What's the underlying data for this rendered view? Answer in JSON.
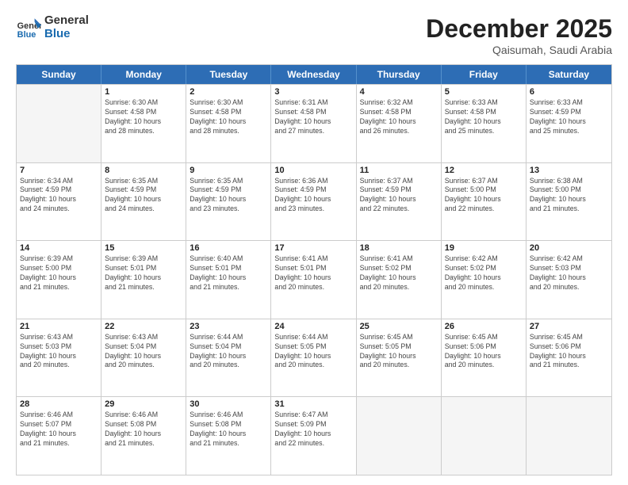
{
  "header": {
    "logo_general": "General",
    "logo_blue": "Blue",
    "month": "December 2025",
    "location": "Qaisumah, Saudi Arabia"
  },
  "weekdays": [
    "Sunday",
    "Monday",
    "Tuesday",
    "Wednesday",
    "Thursday",
    "Friday",
    "Saturday"
  ],
  "rows": [
    [
      {
        "day": "",
        "info": ""
      },
      {
        "day": "1",
        "info": "Sunrise: 6:30 AM\nSunset: 4:58 PM\nDaylight: 10 hours\nand 28 minutes."
      },
      {
        "day": "2",
        "info": "Sunrise: 6:30 AM\nSunset: 4:58 PM\nDaylight: 10 hours\nand 28 minutes."
      },
      {
        "day": "3",
        "info": "Sunrise: 6:31 AM\nSunset: 4:58 PM\nDaylight: 10 hours\nand 27 minutes."
      },
      {
        "day": "4",
        "info": "Sunrise: 6:32 AM\nSunset: 4:58 PM\nDaylight: 10 hours\nand 26 minutes."
      },
      {
        "day": "5",
        "info": "Sunrise: 6:33 AM\nSunset: 4:58 PM\nDaylight: 10 hours\nand 25 minutes."
      },
      {
        "day": "6",
        "info": "Sunrise: 6:33 AM\nSunset: 4:59 PM\nDaylight: 10 hours\nand 25 minutes."
      }
    ],
    [
      {
        "day": "7",
        "info": "Sunrise: 6:34 AM\nSunset: 4:59 PM\nDaylight: 10 hours\nand 24 minutes."
      },
      {
        "day": "8",
        "info": "Sunrise: 6:35 AM\nSunset: 4:59 PM\nDaylight: 10 hours\nand 24 minutes."
      },
      {
        "day": "9",
        "info": "Sunrise: 6:35 AM\nSunset: 4:59 PM\nDaylight: 10 hours\nand 23 minutes."
      },
      {
        "day": "10",
        "info": "Sunrise: 6:36 AM\nSunset: 4:59 PM\nDaylight: 10 hours\nand 23 minutes."
      },
      {
        "day": "11",
        "info": "Sunrise: 6:37 AM\nSunset: 4:59 PM\nDaylight: 10 hours\nand 22 minutes."
      },
      {
        "day": "12",
        "info": "Sunrise: 6:37 AM\nSunset: 5:00 PM\nDaylight: 10 hours\nand 22 minutes."
      },
      {
        "day": "13",
        "info": "Sunrise: 6:38 AM\nSunset: 5:00 PM\nDaylight: 10 hours\nand 21 minutes."
      }
    ],
    [
      {
        "day": "14",
        "info": "Sunrise: 6:39 AM\nSunset: 5:00 PM\nDaylight: 10 hours\nand 21 minutes."
      },
      {
        "day": "15",
        "info": "Sunrise: 6:39 AM\nSunset: 5:01 PM\nDaylight: 10 hours\nand 21 minutes."
      },
      {
        "day": "16",
        "info": "Sunrise: 6:40 AM\nSunset: 5:01 PM\nDaylight: 10 hours\nand 21 minutes."
      },
      {
        "day": "17",
        "info": "Sunrise: 6:41 AM\nSunset: 5:01 PM\nDaylight: 10 hours\nand 20 minutes."
      },
      {
        "day": "18",
        "info": "Sunrise: 6:41 AM\nSunset: 5:02 PM\nDaylight: 10 hours\nand 20 minutes."
      },
      {
        "day": "19",
        "info": "Sunrise: 6:42 AM\nSunset: 5:02 PM\nDaylight: 10 hours\nand 20 minutes."
      },
      {
        "day": "20",
        "info": "Sunrise: 6:42 AM\nSunset: 5:03 PM\nDaylight: 10 hours\nand 20 minutes."
      }
    ],
    [
      {
        "day": "21",
        "info": "Sunrise: 6:43 AM\nSunset: 5:03 PM\nDaylight: 10 hours\nand 20 minutes."
      },
      {
        "day": "22",
        "info": "Sunrise: 6:43 AM\nSunset: 5:04 PM\nDaylight: 10 hours\nand 20 minutes."
      },
      {
        "day": "23",
        "info": "Sunrise: 6:44 AM\nSunset: 5:04 PM\nDaylight: 10 hours\nand 20 minutes."
      },
      {
        "day": "24",
        "info": "Sunrise: 6:44 AM\nSunset: 5:05 PM\nDaylight: 10 hours\nand 20 minutes."
      },
      {
        "day": "25",
        "info": "Sunrise: 6:45 AM\nSunset: 5:05 PM\nDaylight: 10 hours\nand 20 minutes."
      },
      {
        "day": "26",
        "info": "Sunrise: 6:45 AM\nSunset: 5:06 PM\nDaylight: 10 hours\nand 20 minutes."
      },
      {
        "day": "27",
        "info": "Sunrise: 6:45 AM\nSunset: 5:06 PM\nDaylight: 10 hours\nand 21 minutes."
      }
    ],
    [
      {
        "day": "28",
        "info": "Sunrise: 6:46 AM\nSunset: 5:07 PM\nDaylight: 10 hours\nand 21 minutes."
      },
      {
        "day": "29",
        "info": "Sunrise: 6:46 AM\nSunset: 5:08 PM\nDaylight: 10 hours\nand 21 minutes."
      },
      {
        "day": "30",
        "info": "Sunrise: 6:46 AM\nSunset: 5:08 PM\nDaylight: 10 hours\nand 21 minutes."
      },
      {
        "day": "31",
        "info": "Sunrise: 6:47 AM\nSunset: 5:09 PM\nDaylight: 10 hours\nand 22 minutes."
      },
      {
        "day": "",
        "info": ""
      },
      {
        "day": "",
        "info": ""
      },
      {
        "day": "",
        "info": ""
      }
    ]
  ]
}
